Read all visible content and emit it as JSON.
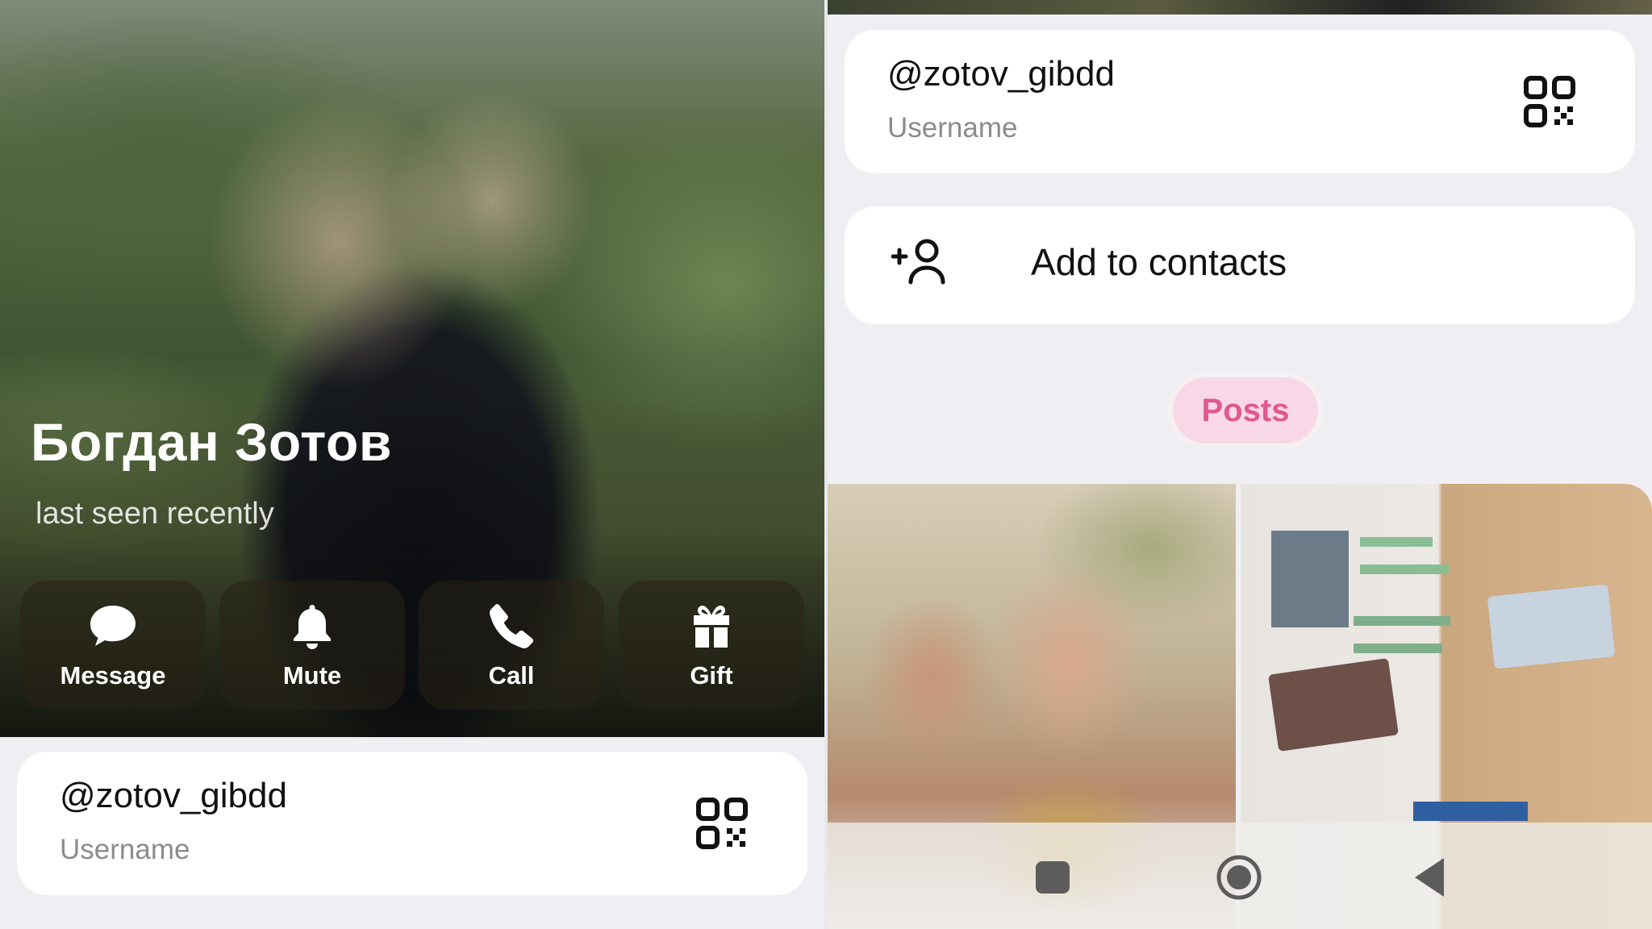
{
  "profile": {
    "name": "Богдан Зотов",
    "status": "last seen recently"
  },
  "actions": [
    {
      "label": "Message",
      "icon": "message-icon"
    },
    {
      "label": "Mute",
      "icon": "bell-icon"
    },
    {
      "label": "Call",
      "icon": "phone-icon"
    },
    {
      "label": "Gift",
      "icon": "gift-icon"
    }
  ],
  "username_card": {
    "value": "@zotov_gibdd",
    "caption": "Username",
    "icon": "qr-code-icon"
  },
  "add_contact": {
    "label": "Add to contacts",
    "icon": "add-person-icon"
  },
  "tabs": {
    "posts": "Posts"
  },
  "nav": {
    "icons": [
      "recent-apps-icon",
      "home-icon",
      "back-icon"
    ]
  },
  "colors": {
    "accent": "#e0588f",
    "tab_bg": "#f8d8e6",
    "page_bg": "#efeff3",
    "card_bg": "#ffffff"
  }
}
